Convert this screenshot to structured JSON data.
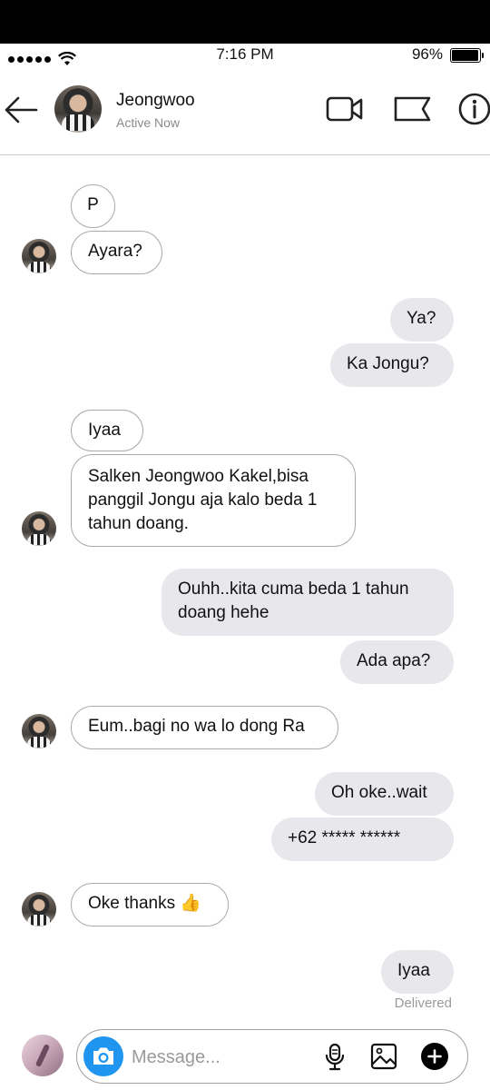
{
  "status_bar": {
    "time": "7:16 PM",
    "battery": "96%",
    "battery_level": 0.96
  },
  "header": {
    "contact_name": "Jeongwoo",
    "contact_status": "Active Now"
  },
  "messages": [
    {
      "text": "P"
    },
    {
      "text": "Ayara?"
    },
    {
      "text": "Ya?"
    },
    {
      "text": "Ka Jongu?"
    },
    {
      "text": "Iyaa"
    },
    {
      "text": "Salken Jeongwoo Kakel,bisa\npanggil Jongu aja kalo beda 1\ntahun doang."
    },
    {
      "text": "Ouhh..kita cuma beda 1 tahun\ndoang hehe"
    },
    {
      "text": "Ada apa?"
    },
    {
      "text": "Eum..bagi no wa lo dong Ra"
    },
    {
      "text": "Oh oke..wait"
    },
    {
      "text": "+62 ***** ******"
    },
    {
      "text": "Oke thanks 👍"
    },
    {
      "text": "Iyaa"
    }
  ],
  "delivered": "Delivered",
  "composer": {
    "placeholder": "Message..."
  },
  "colors": {
    "camera_button": "#1f95f0",
    "outgoing_bubble": "#e8e8ec",
    "incoming_border": "#a9a9a9"
  }
}
